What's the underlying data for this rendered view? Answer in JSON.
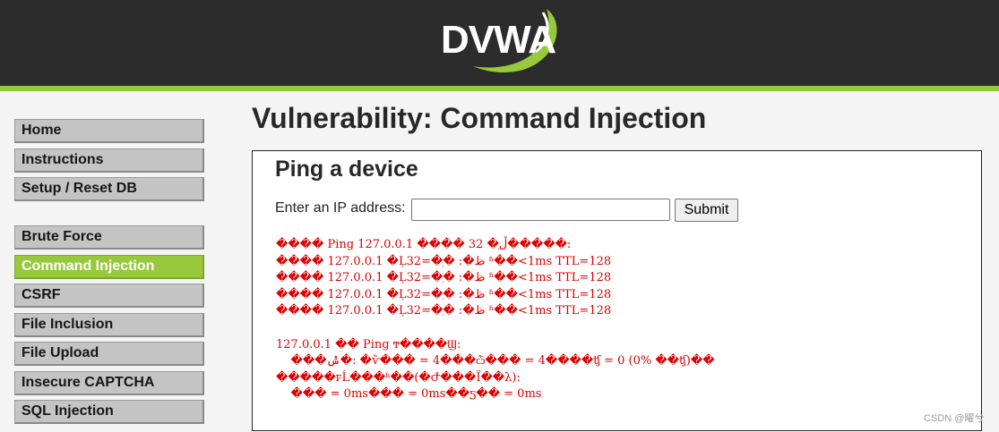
{
  "header": {
    "logo_text": "DVWA",
    "accent_color": "#98c93c",
    "background_color": "#2c2c2c"
  },
  "menu": {
    "group_a": [
      "Home",
      "Instructions",
      "Setup / Reset DB"
    ],
    "group_b": [
      "Brute Force",
      "Command Injection",
      "CSRF",
      "File Inclusion",
      "File Upload",
      "Insecure CAPTCHA",
      "SQL Injection"
    ],
    "selected": "Command Injection"
  },
  "main": {
    "title": "Vulnerability: Command Injection",
    "box_title": "Ping a device",
    "ip_label": "Enter an IP address:",
    "ip_value": "",
    "submit_label": "Submit",
    "output_lines": [
      "���� Ping 127.0.0.1 ���� 32 �ֽڵ�����:",
      "���� 127.0.0.1 �Ļظ�: �ֽ�=32 ʱ��<1ms TTL=128",
      "���� 127.0.0.1 �Ļظ�: �ֽ�=32 ʱ��<1ms TTL=128",
      "���� 127.0.0.1 �Ļظ�: �ֽ�=32 ʱ��<1ms TTL=128",
      "���� 127.0.0.1 �Ļظ�: �ֽ�=32 ʱ��<1ms TTL=128",
      "",
      "127.0.0.1 �� Ping ͳ����Ϣ:",
      "    ���ݰ�: �ѷ��� = 4���ѽ��� = 4����ʧ = 0 (0% ��ʧ)��",
      "�����г̵Ĺ���ʱ��(�Ժ���Ϊ��λ):",
      "    ��� = 0ms��� = 0ms��ƽ�� = 0ms"
    ],
    "output_color": "#dd0000"
  },
  "watermark": "CSDN @曜兮"
}
